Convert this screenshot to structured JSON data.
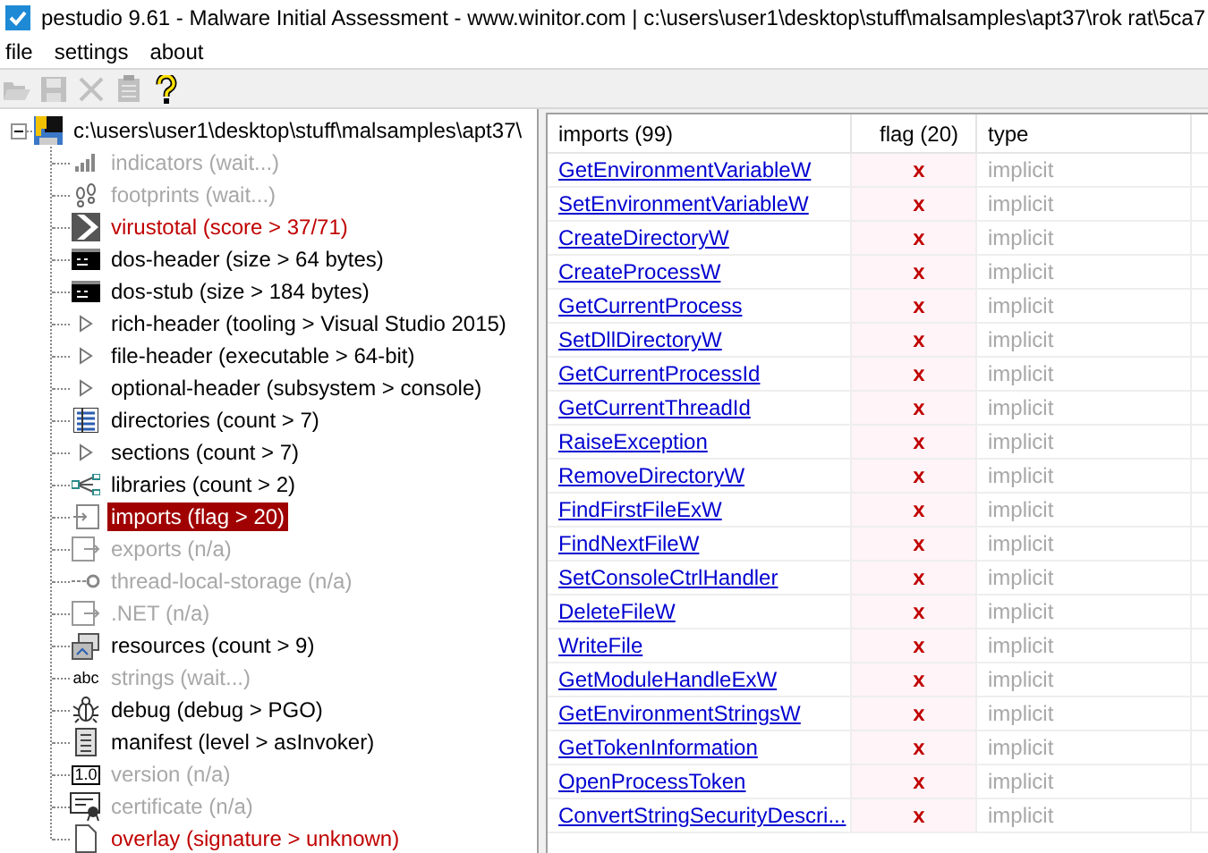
{
  "window": {
    "title": "pestudio 9.61 - Malware Initial Assessment - www.winitor.com | c:\\users\\user1\\desktop\\stuff\\malsamples\\apt37\\rok rat\\5ca7"
  },
  "menu": [
    "file",
    "settings",
    "about"
  ],
  "toolbar": [
    {
      "kind": "open",
      "disabled": true
    },
    {
      "kind": "save",
      "disabled": true
    },
    {
      "kind": "close",
      "disabled": true
    },
    {
      "kind": "clipboard",
      "disabled": true
    },
    {
      "kind": "help",
      "disabled": false
    }
  ],
  "tree": {
    "root": {
      "label": "c:\\users\\user1\\desktop\\stuff\\malsamples\\apt37\\",
      "expanded": true
    },
    "children": [
      {
        "label": "indicators (wait...)",
        "kind": "bars",
        "disabled": true,
        "flagged": false,
        "selected": false
      },
      {
        "label": "footprints (wait...)",
        "kind": "footprints",
        "disabled": true,
        "flagged": false,
        "selected": false
      },
      {
        "label": "virustotal (score > 37/71)",
        "kind": "chevron",
        "disabled": false,
        "flagged": true,
        "selected": false
      },
      {
        "label": "dos-header (size > 64 bytes)",
        "kind": "console",
        "disabled": false,
        "flagged": false,
        "selected": false
      },
      {
        "label": "dos-stub (size > 184 bytes)",
        "kind": "console",
        "disabled": false,
        "flagged": false,
        "selected": false
      },
      {
        "label": "rich-header (tooling > Visual Studio 2015)",
        "kind": "triangle",
        "disabled": false,
        "flagged": false,
        "selected": false
      },
      {
        "label": "file-header (executable > 64-bit)",
        "kind": "triangle",
        "disabled": false,
        "flagged": false,
        "selected": false
      },
      {
        "label": "optional-header (subsystem > console)",
        "kind": "triangle",
        "disabled": false,
        "flagged": false,
        "selected": false
      },
      {
        "label": "directories (count > 7)",
        "kind": "grid",
        "disabled": false,
        "flagged": false,
        "selected": false
      },
      {
        "label": "sections (count > 7)",
        "kind": "triangle",
        "disabled": false,
        "flagged": false,
        "selected": false
      },
      {
        "label": "libraries (count > 2)",
        "kind": "nodes",
        "disabled": false,
        "flagged": false,
        "selected": false
      },
      {
        "label": "imports (flag > 20)",
        "kind": "import",
        "disabled": false,
        "flagged": false,
        "selected": true
      },
      {
        "label": "exports (n/a)",
        "kind": "export",
        "disabled": true,
        "flagged": false,
        "selected": false
      },
      {
        "label": "thread-local-storage (n/a)",
        "kind": "link",
        "disabled": true,
        "flagged": false,
        "selected": false
      },
      {
        "label": ".NET (n/a)",
        "kind": "export",
        "disabled": true,
        "flagged": false,
        "selected": false
      },
      {
        "label": "resources (count > 9)",
        "kind": "resources",
        "disabled": false,
        "flagged": false,
        "selected": false
      },
      {
        "label": "strings (wait...)",
        "kind": "text",
        "icon_text": "abc",
        "disabled": true,
        "flagged": false,
        "selected": false
      },
      {
        "label": "debug (debug > PGO)",
        "kind": "bug",
        "disabled": false,
        "flagged": false,
        "selected": false
      },
      {
        "label": "manifest (level > asInvoker)",
        "kind": "document",
        "disabled": false,
        "flagged": false,
        "selected": false
      },
      {
        "label": "version (n/a)",
        "kind": "boxtext",
        "icon_text": "1.0",
        "disabled": true,
        "flagged": false,
        "selected": false
      },
      {
        "label": "certificate (n/a)",
        "kind": "certificate",
        "disabled": true,
        "flagged": false,
        "selected": false
      },
      {
        "label": "overlay (signature > unknown)",
        "kind": "page",
        "disabled": false,
        "flagged": true,
        "selected": false
      }
    ]
  },
  "table": {
    "columns": [
      "imports (99)",
      "flag (20)",
      "type"
    ],
    "rows": [
      {
        "name": "GetEnvironmentVariableW",
        "flag": "x",
        "type": "implicit"
      },
      {
        "name": "SetEnvironmentVariableW",
        "flag": "x",
        "type": "implicit"
      },
      {
        "name": "CreateDirectoryW",
        "flag": "x",
        "type": "implicit"
      },
      {
        "name": "CreateProcessW",
        "flag": "x",
        "type": "implicit"
      },
      {
        "name": "GetCurrentProcess",
        "flag": "x",
        "type": "implicit"
      },
      {
        "name": "SetDllDirectoryW",
        "flag": "x",
        "type": "implicit"
      },
      {
        "name": "GetCurrentProcessId",
        "flag": "x",
        "type": "implicit"
      },
      {
        "name": "GetCurrentThreadId",
        "flag": "x",
        "type": "implicit"
      },
      {
        "name": "RaiseException",
        "flag": "x",
        "type": "implicit"
      },
      {
        "name": "RemoveDirectoryW",
        "flag": "x",
        "type": "implicit"
      },
      {
        "name": "FindFirstFileExW",
        "flag": "x",
        "type": "implicit"
      },
      {
        "name": "FindNextFileW",
        "flag": "x",
        "type": "implicit"
      },
      {
        "name": "SetConsoleCtrlHandler",
        "flag": "x",
        "type": "implicit"
      },
      {
        "name": "DeleteFileW",
        "flag": "x",
        "type": "implicit"
      },
      {
        "name": "WriteFile",
        "flag": "x",
        "type": "implicit"
      },
      {
        "name": "GetModuleHandleExW",
        "flag": "x",
        "type": "implicit"
      },
      {
        "name": "GetEnvironmentStringsW",
        "flag": "x",
        "type": "implicit"
      },
      {
        "name": "GetTokenInformation",
        "flag": "x",
        "type": "implicit"
      },
      {
        "name": "OpenProcessToken",
        "flag": "x",
        "type": "implicit"
      },
      {
        "name": "ConvertStringSecurityDescri...",
        "flag": "x",
        "type": "implicit"
      }
    ]
  }
}
